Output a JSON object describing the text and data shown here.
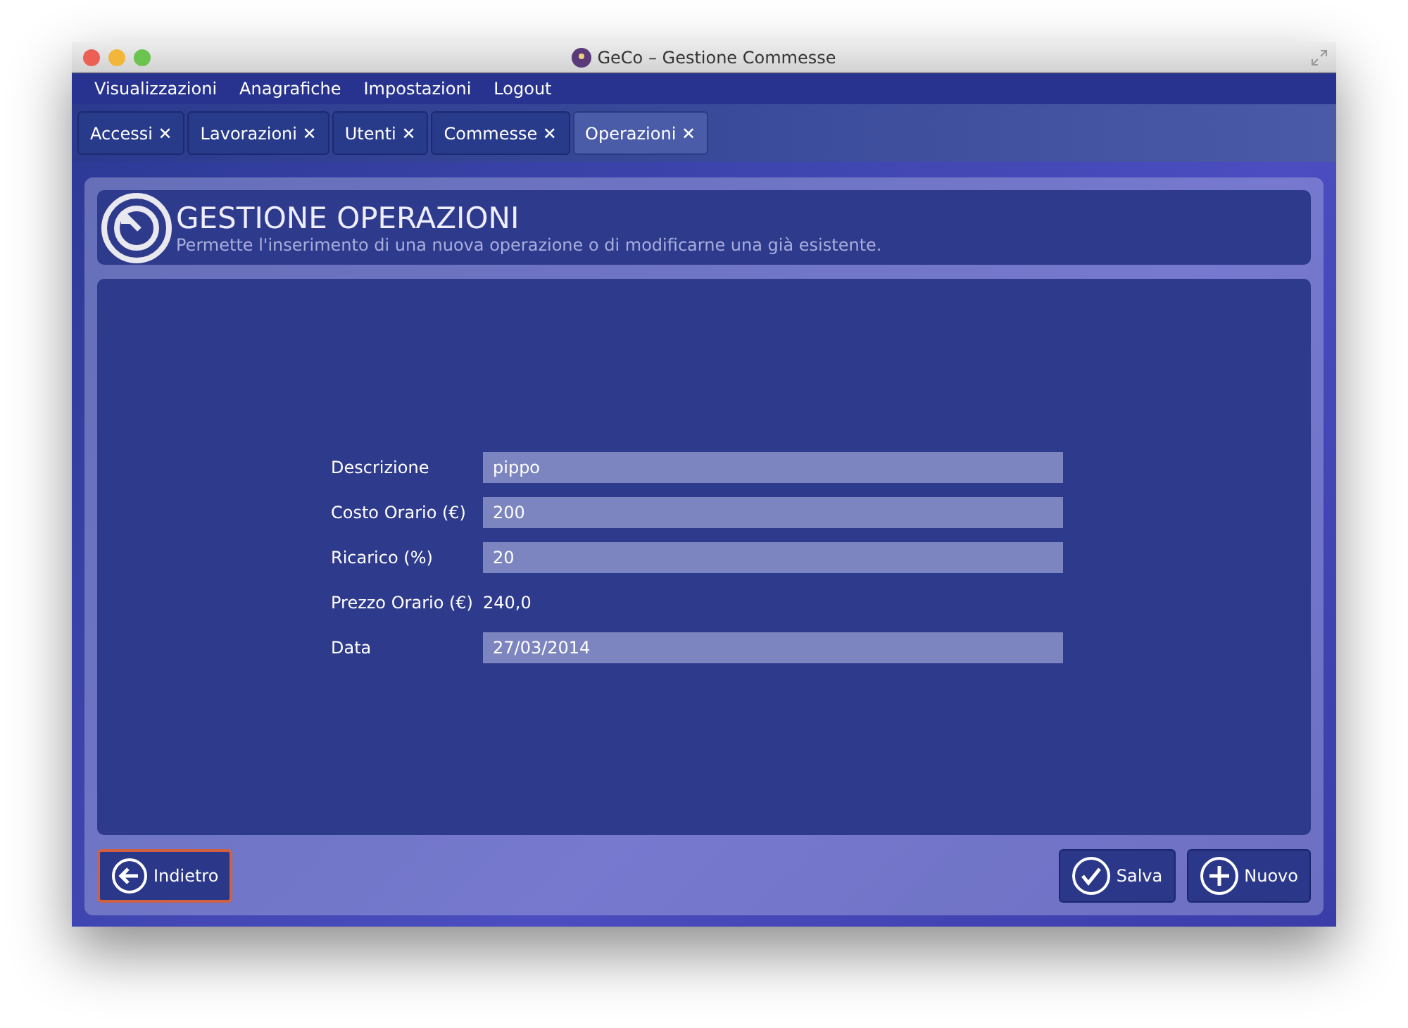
{
  "window": {
    "title": "GeCo – Gestione Commesse"
  },
  "menu": [
    "Visualizzazioni",
    "Anagrafiche",
    "Impostazioni",
    "Logout"
  ],
  "tabs": [
    {
      "label": "Accessi ✕",
      "selected": false
    },
    {
      "label": "Lavorazioni ✕",
      "selected": false
    },
    {
      "label": "Utenti ✕",
      "selected": false
    },
    {
      "label": "Commesse ✕",
      "selected": false
    },
    {
      "label": "Operazioni ✕",
      "selected": true
    }
  ],
  "header": {
    "title": "GESTIONE OPERAZIONI",
    "subtitle": "Permette l'inserimento di una nuova operazione o di modificarne una già esistente."
  },
  "fields": [
    {
      "label": "Descrizione",
      "kind": "input",
      "value": "pippo"
    },
    {
      "label": "Costo Orario (€)",
      "kind": "input",
      "value": "200"
    },
    {
      "label": "Ricarico (%)",
      "kind": "input",
      "value": "20"
    },
    {
      "label": "Prezzo Orario (€)",
      "kind": "text",
      "value": "240,0"
    },
    {
      "label": "Data",
      "kind": "input",
      "value": "27/03/2014"
    }
  ],
  "buttons": [
    {
      "label": "Indietro",
      "kind": "back",
      "focused": true
    },
    {
      "label": "Salva",
      "kind": "save",
      "focused": false
    },
    {
      "label": "Nuovo",
      "kind": "new",
      "focused": false
    }
  ]
}
